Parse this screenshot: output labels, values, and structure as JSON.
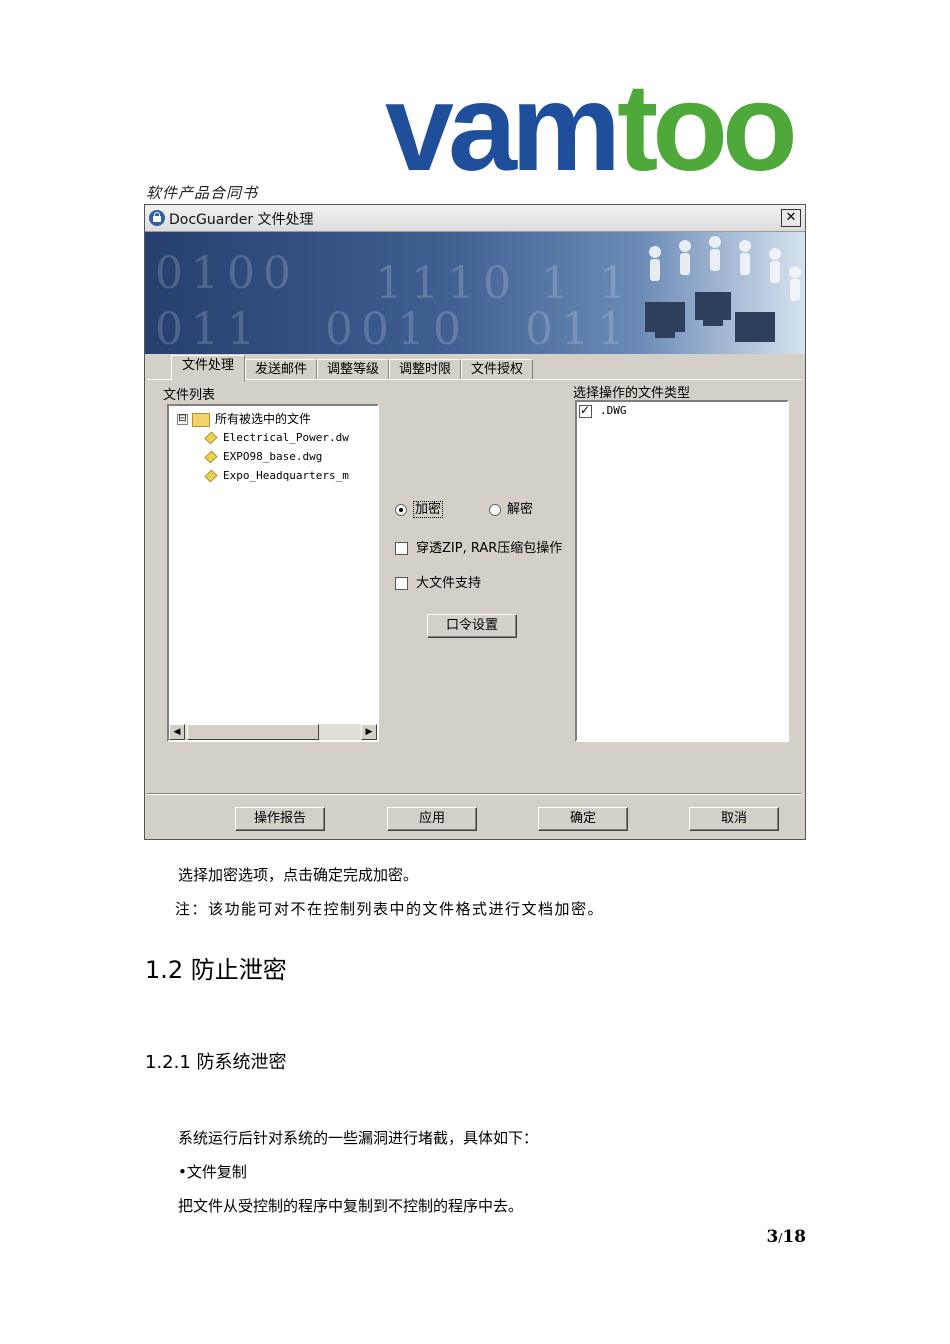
{
  "logo": {
    "text": "vamtoo",
    "colors": {
      "blue": "#1f4f9a",
      "green": "#4fa83a"
    }
  },
  "header_caption": "软件产品合同书",
  "dialog": {
    "title": "DocGuarder 文件处理",
    "close_label": "✕",
    "banner_digits": [
      "0100",
      "1110 1 1",
      "011",
      "0010",
      "011"
    ],
    "tabs": [
      "文件处理",
      "发送邮件",
      "调整等级",
      "调整时限",
      "文件授权"
    ],
    "file_list_label": "文件列表",
    "tree": {
      "expander": "⊟",
      "root": "所有被选中的文件",
      "files": [
        "Electrical_Power.dw",
        "EXPO98_base.dwg",
        "Expo_Headquarters_m"
      ]
    },
    "options": {
      "encrypt": "加密",
      "decrypt": "解密",
      "zip_rar": "穿透ZIP, RAR压缩包操作",
      "large_file": "大文件支持",
      "password_button": "口令设置"
    },
    "filetype_label": "选择操作的文件类型",
    "filetypes": [
      ".DWG"
    ],
    "buttons": {
      "report": "操作报告",
      "apply": "应用",
      "ok": "确定",
      "cancel": "取消"
    }
  },
  "body": {
    "line1": "选择加密选项，点击确定完成加密。",
    "line2": "注：该功能可对不在控制列表中的文件格式进行文档加密。",
    "h2": "1.2 防止泄密",
    "h3": "1.2.1 防系统泄密",
    "line3": "系统运行后针对系统的一些漏洞进行堵截，具体如下：",
    "bullet": "•文件复制",
    "line4": "把文件从受控制的程序中复制到不控制的程序中去。"
  },
  "page": {
    "current": "3",
    "sep": "/",
    "total": "18"
  }
}
